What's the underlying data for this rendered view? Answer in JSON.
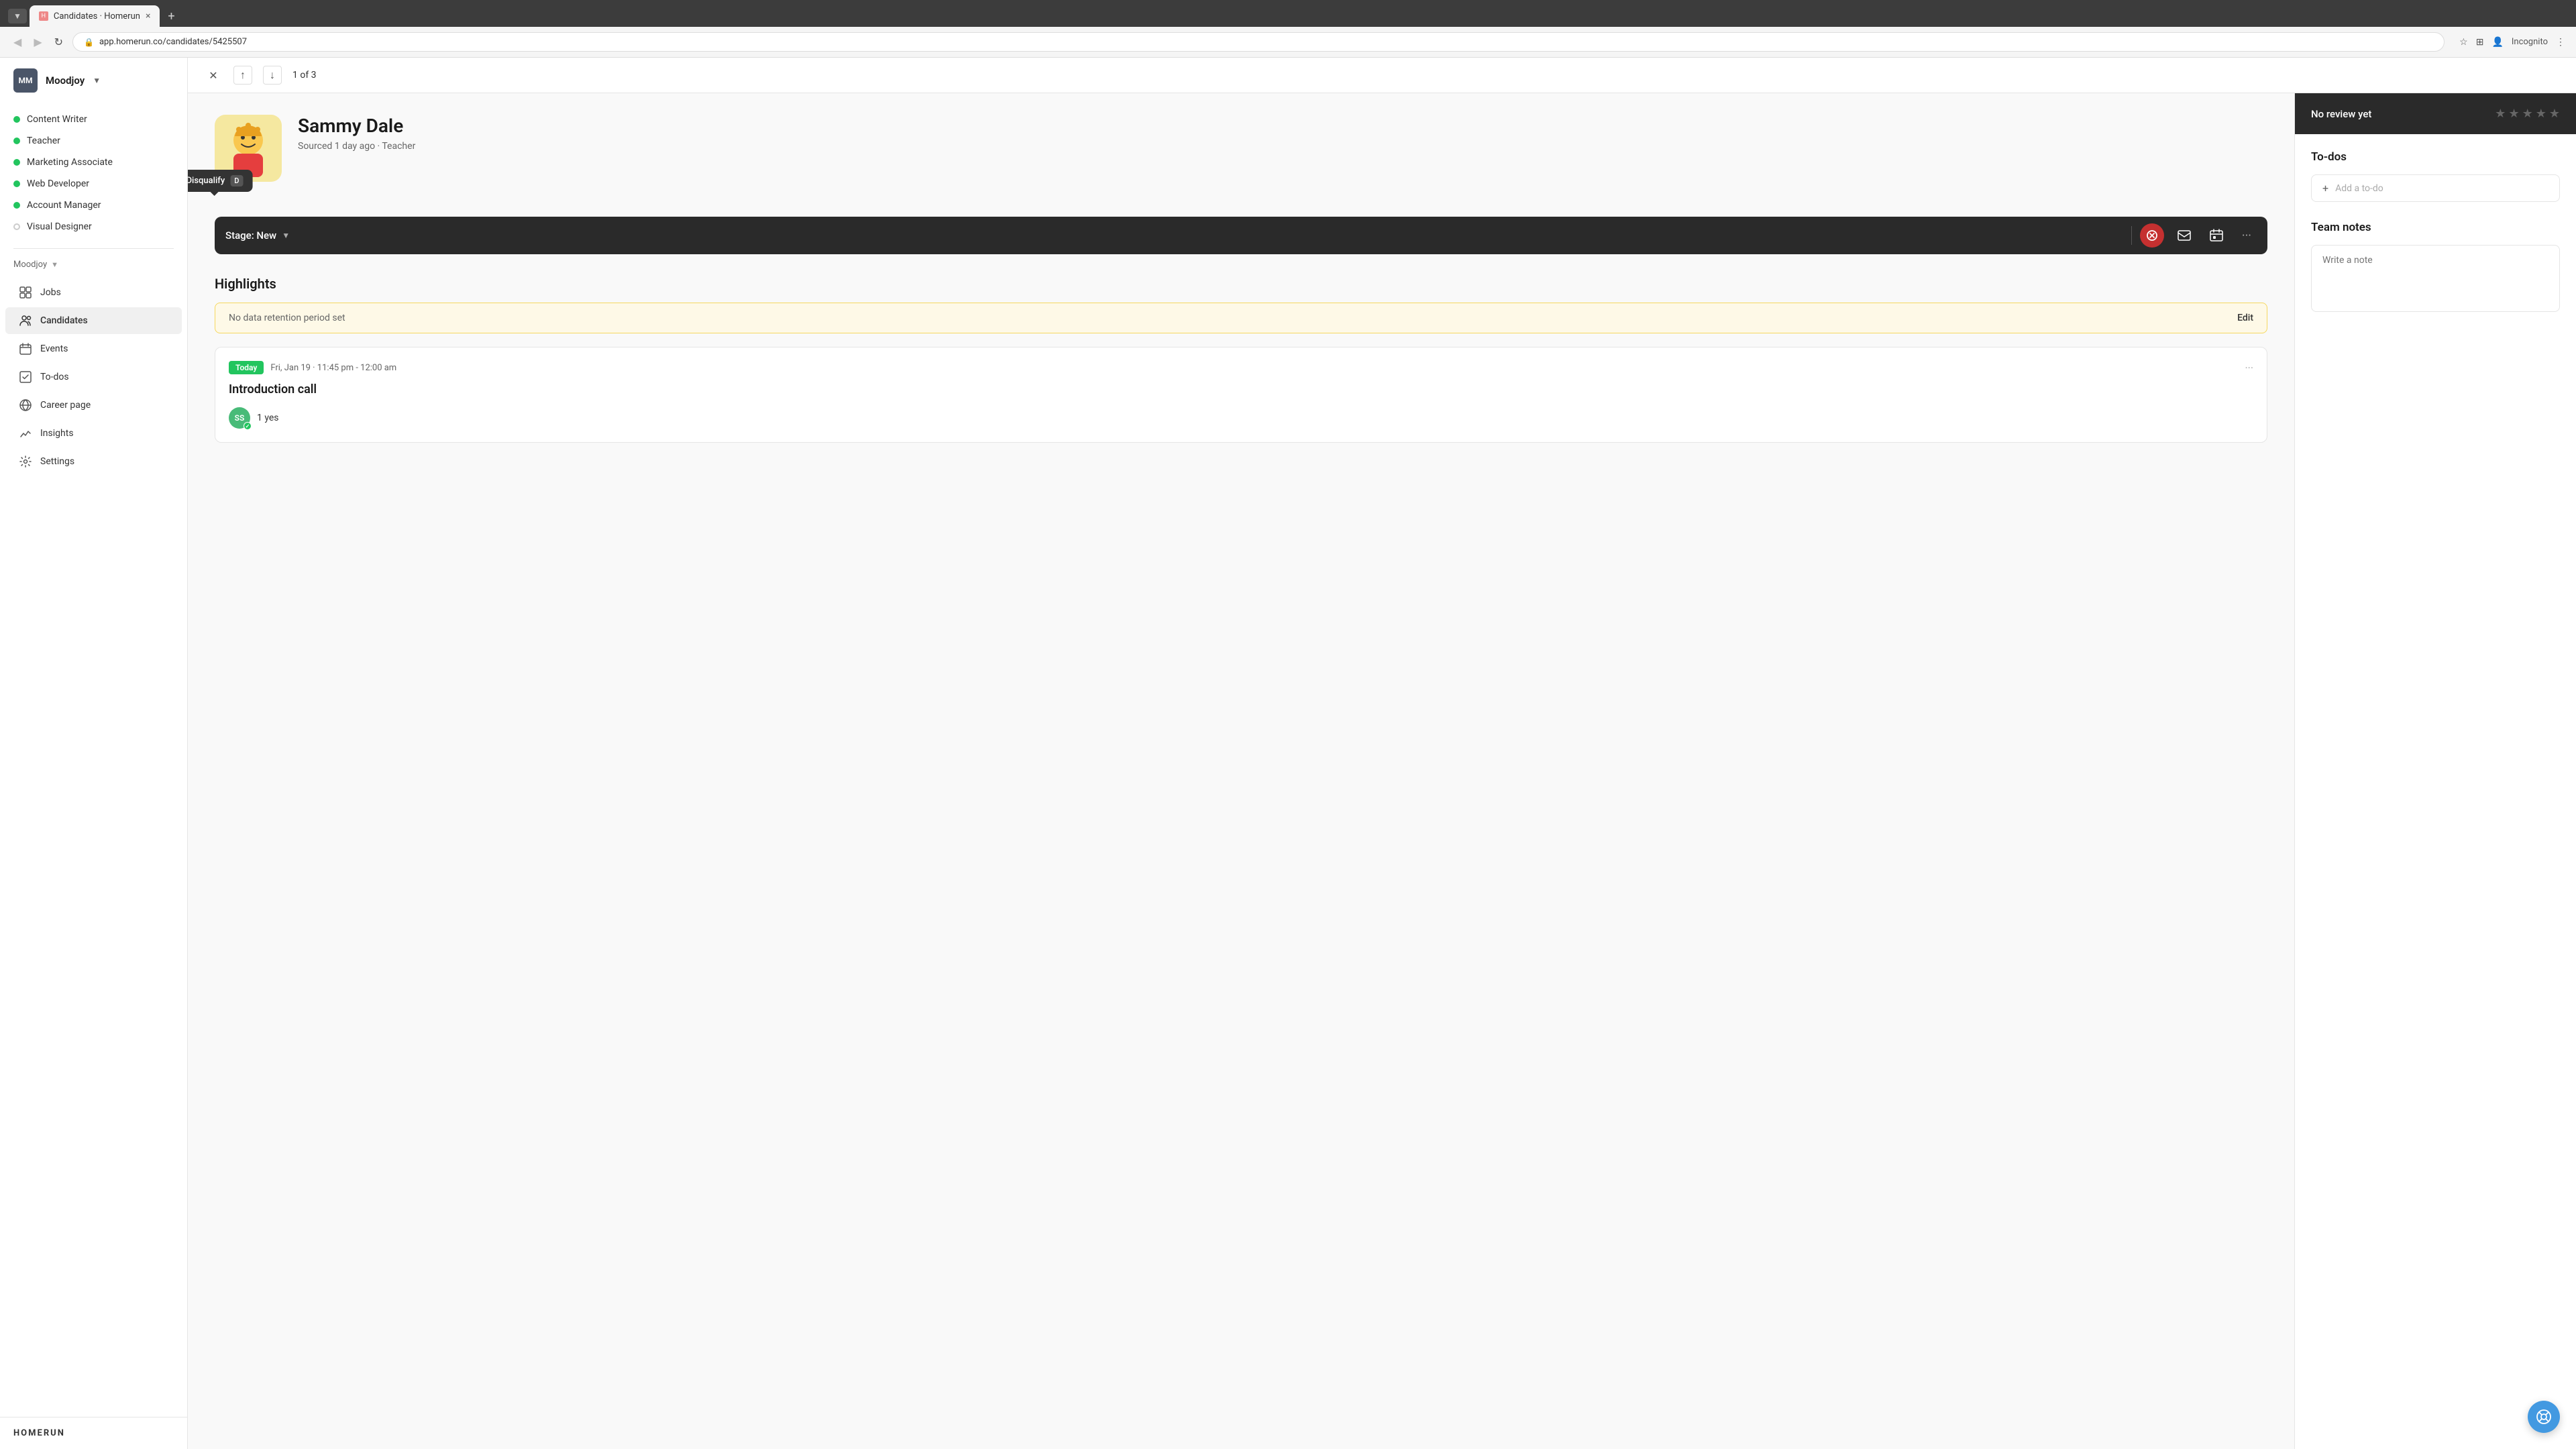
{
  "browser": {
    "tab_label": "Candidates · Homerun",
    "url": "app.homerun.co/candidates/5425507",
    "incognito_label": "Incognito"
  },
  "sidebar": {
    "org_name": "Moodjoy",
    "avatar_initials": "MM",
    "jobs": [
      {
        "label": "Content Writer",
        "dot": "green"
      },
      {
        "label": "Teacher",
        "dot": "green"
      },
      {
        "label": "Marketing Associate",
        "dot": "green"
      },
      {
        "label": "Web Developer",
        "dot": "green"
      },
      {
        "label": "Account Manager",
        "dot": "green"
      },
      {
        "label": "Visual Designer",
        "dot": "outline"
      }
    ],
    "section_label": "Moodjoy",
    "nav_items": [
      {
        "label": "Jobs",
        "icon": "grid-icon"
      },
      {
        "label": "Candidates",
        "icon": "users-icon",
        "active": true
      },
      {
        "label": "Events",
        "icon": "calendar-icon"
      },
      {
        "label": "To-dos",
        "icon": "checklist-icon"
      },
      {
        "label": "Career page",
        "icon": "globe-icon"
      },
      {
        "label": "Insights",
        "icon": "chart-icon"
      },
      {
        "label": "Settings",
        "icon": "gear-icon"
      }
    ],
    "logo": "HOMERUN"
  },
  "topbar": {
    "pagination": "1 of 3"
  },
  "candidate": {
    "name": "Sammy Dale",
    "meta": "Sourced 1 day ago · Teacher",
    "stage": "Stage: New",
    "disqualify_label": "Disqualify",
    "disqualify_key": "D"
  },
  "highlights": {
    "title": "Highlights",
    "warning": "No data retention period set",
    "edit_label": "Edit",
    "event": {
      "badge": "Today",
      "time": "Fri, Jan 19 · 11:45 pm - 12:00 am",
      "title": "Introduction call",
      "attendee_initials": "SS",
      "attendee_count": "1 yes",
      "menu_dots": "···"
    }
  },
  "right_panel": {
    "review_label": "No review yet",
    "stars": [
      "★",
      "★",
      "★",
      "★",
      "★"
    ],
    "todos_title": "To-dos",
    "todo_placeholder": "Add a to-do",
    "team_notes_title": "Team notes",
    "team_notes_placeholder": "Write a note"
  },
  "support_icon": "?"
}
